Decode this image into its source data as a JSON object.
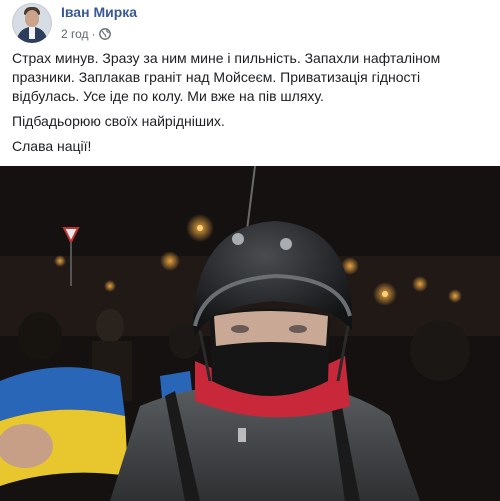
{
  "post": {
    "author": "Іван Мирка",
    "time": "2 год",
    "separator": "·",
    "privacy_icon": "globe-icon",
    "paragraphs": [
      "Страх минув. Зразу за ним мине і пильність. Запахли нафталіном празники. Заплакав граніт над Мойсеєм. Приватизація гідності відбулась. Усе іде по колу. Ми вже на пів шляху.",
      "Підбадьорюю своїх найрідніших.",
      "Слава нації!"
    ],
    "photo_description": "night-protest-photo"
  },
  "colors": {
    "author_link": "#385898",
    "meta_text": "#616770",
    "body_text": "#1c1e21",
    "flag_blue": "#2a66b8",
    "flag_yellow": "#e8c72e"
  }
}
